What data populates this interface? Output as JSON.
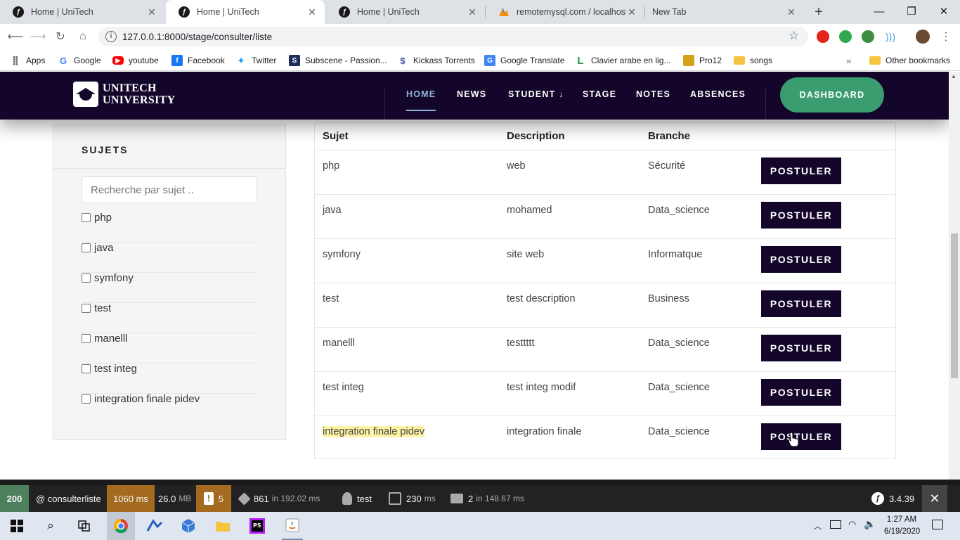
{
  "browser": {
    "tabs": [
      {
        "title": "Home | UniTech",
        "icon": "symfony-icon"
      },
      {
        "title": "Home | UniTech",
        "icon": "symfony-icon"
      },
      {
        "title": "Home | UniTech",
        "icon": "symfony-icon"
      },
      {
        "title": "remotemysql.com / localhost /",
        "icon": "phpmyadmin-icon"
      },
      {
        "title": "New Tab",
        "icon": ""
      }
    ],
    "active_tab": 1,
    "url": "127.0.0.1:8000/stage/consulter/liste",
    "bookmarks": [
      {
        "label": "Apps",
        "color": "#e94235"
      },
      {
        "label": "Google",
        "color": "#4285f4"
      },
      {
        "label": "youtube",
        "color": "#ff0000"
      },
      {
        "label": "Facebook",
        "color": "#1877f2"
      },
      {
        "label": "Twitter",
        "color": "#1da1f2"
      },
      {
        "label": "Subscene - Passion...",
        "color": "#1c2e59"
      },
      {
        "label": "Kickass Torrents",
        "color": "#3d5aa8"
      },
      {
        "label": "Google Translate",
        "color": "#4285f4"
      },
      {
        "label": "Clavier arabe en lig...",
        "color": "#1e9a3c"
      },
      {
        "label": "Pro12",
        "color": "#d5a21c"
      },
      {
        "label": "songs",
        "color": "#f5c542"
      }
    ],
    "other_bookmarks": "Other bookmarks"
  },
  "site": {
    "logo_line1": "UNITECH",
    "logo_line2": "UNIVERSITY",
    "menu": [
      "HOME",
      "NEWS",
      "STUDENT ↓",
      "STAGE",
      "NOTES",
      "ABSENCES"
    ],
    "dashboard_label": "DASHBOARD"
  },
  "sidebar": {
    "title": "SUJETS",
    "search_placeholder": "Recherche par sujet ..",
    "options": [
      "php",
      "java",
      "symfony",
      "test",
      "manelll",
      "test integ",
      "integration finale pidev"
    ]
  },
  "table": {
    "headers": [
      "Sujet",
      "Description",
      "Branche"
    ],
    "action_label": "POSTULER",
    "rows": [
      {
        "sujet": "php",
        "description": "web",
        "branche": "Sécurité"
      },
      {
        "sujet": "java",
        "description": "mohamed",
        "branche": "Data_science"
      },
      {
        "sujet": "symfony",
        "description": "site web",
        "branche": "Informatque"
      },
      {
        "sujet": "test",
        "description": "test description",
        "branche": "Business"
      },
      {
        "sujet": "manelll",
        "description": "testtttt",
        "branche": "Data_science"
      },
      {
        "sujet": "test integ",
        "description": "test integ modif",
        "branche": "Data_science"
      },
      {
        "sujet": "integration finale pidev",
        "description": "integration finale",
        "branche": "Data_science"
      }
    ]
  },
  "debug": {
    "status": "200",
    "route": "@ consulterliste",
    "time": "1060 ms",
    "memory": "26.0",
    "memory_unit": "MB",
    "warnings": "5",
    "queries": "861",
    "queries_time": "in 192.02 ms",
    "user": "test",
    "render": "230",
    "render_unit": "ms",
    "cache": "2",
    "cache_time": "in 148.67 ms",
    "version": "3.4.39"
  },
  "taskbar": {
    "time": "1:27 AM",
    "date": "6/19/2020"
  },
  "colors": {
    "header_bg": "#14062a",
    "dashboard_green": "#3a9d6f",
    "active_menu": "#8fb6d8",
    "highlight": "#fdf3a5"
  }
}
